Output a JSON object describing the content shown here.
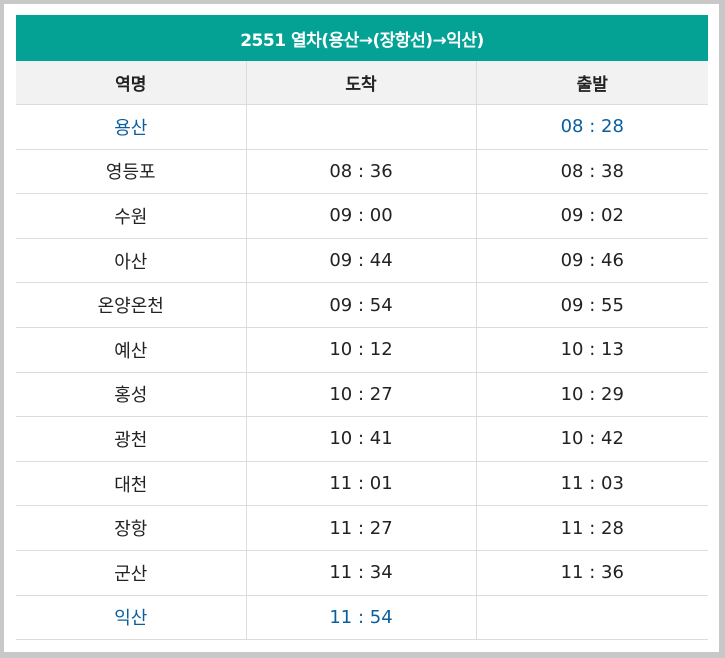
{
  "title": "2551 열차(용산→(장항선)→익산)",
  "colors": {
    "header_bg": "#03a295",
    "highlight_text": "#0a5e9e"
  },
  "columns": [
    "역명",
    "도착",
    "출발"
  ],
  "rows": [
    {
      "station": "용산",
      "arrival": "",
      "departure": "08 : 28",
      "highlight": true
    },
    {
      "station": "영등포",
      "arrival": "08 : 36",
      "departure": "08 : 38",
      "highlight": false
    },
    {
      "station": "수원",
      "arrival": "09 : 00",
      "departure": "09 : 02",
      "highlight": false
    },
    {
      "station": "아산",
      "arrival": "09 : 44",
      "departure": "09 : 46",
      "highlight": false
    },
    {
      "station": "온양온천",
      "arrival": "09 : 54",
      "departure": "09 : 55",
      "highlight": false
    },
    {
      "station": "예산",
      "arrival": "10 : 12",
      "departure": "10 : 13",
      "highlight": false
    },
    {
      "station": "홍성",
      "arrival": "10 : 27",
      "departure": "10 : 29",
      "highlight": false
    },
    {
      "station": "광천",
      "arrival": "10 : 41",
      "departure": "10 : 42",
      "highlight": false
    },
    {
      "station": "대천",
      "arrival": "11 : 01",
      "departure": "11 : 03",
      "highlight": false
    },
    {
      "station": "장항",
      "arrival": "11 : 27",
      "departure": "11 : 28",
      "highlight": false
    },
    {
      "station": "군산",
      "arrival": "11 : 34",
      "departure": "11 : 36",
      "highlight": false
    },
    {
      "station": "익산",
      "arrival": "11 : 54",
      "departure": "",
      "highlight": true
    }
  ]
}
